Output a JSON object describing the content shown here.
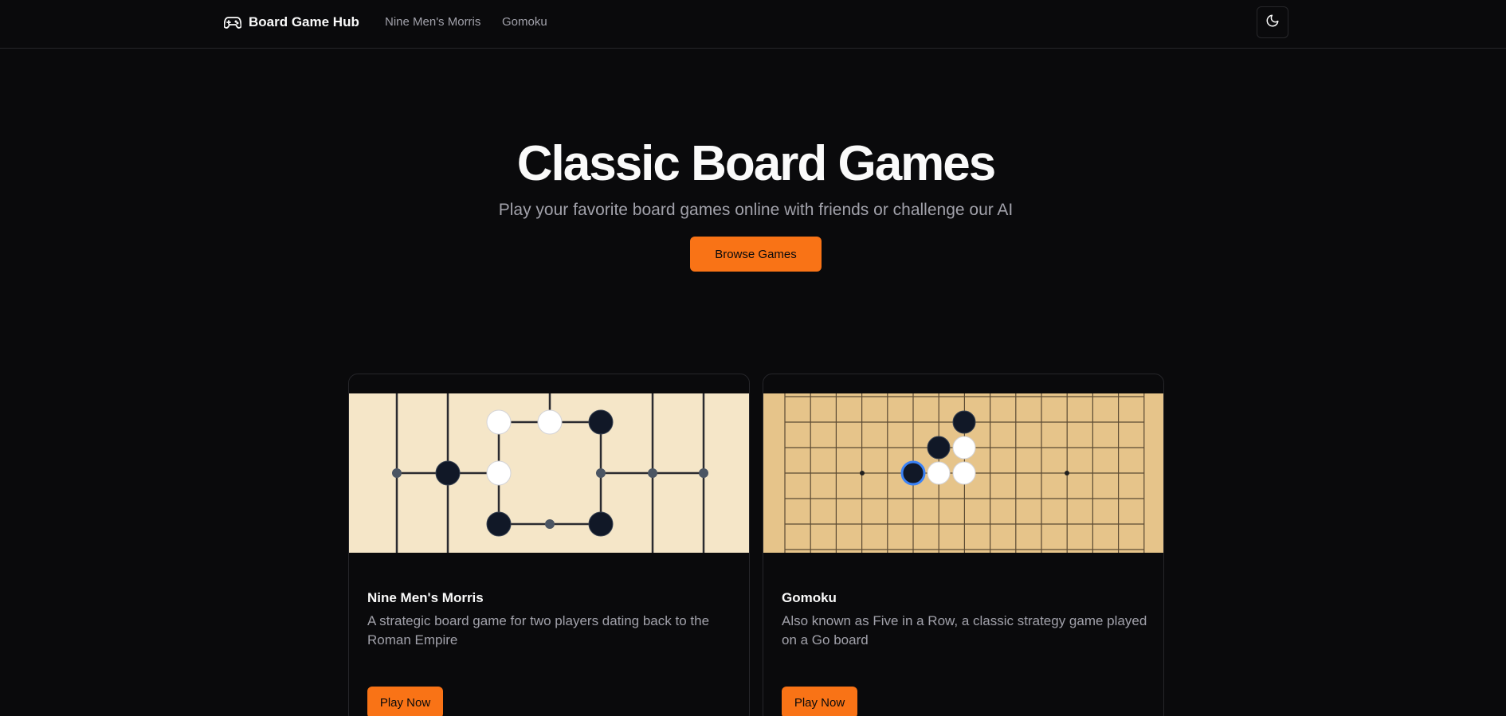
{
  "header": {
    "brand": "Board Game Hub",
    "brand_icon": "gamepad-icon",
    "nav": [
      "Nine Men's Morris",
      "Gomoku"
    ],
    "theme_toggle_icon": "moon-icon"
  },
  "hero": {
    "title": "Classic Board Games",
    "subtitle": "Play your favorite board games online with friends or challenge our AI",
    "cta": "Browse Games"
  },
  "games": [
    {
      "title": "Nine Men's Morris",
      "description": "A strategic board game for two players dating back to the Roman Empire",
      "button": "Play Now",
      "board_color": "#f5e6c8"
    },
    {
      "title": "Gomoku",
      "description": "Also known as Five in a Row, a classic strategy game played on a Go board",
      "button": "Play Now",
      "board_color": "#e6c48a"
    }
  ],
  "colors": {
    "accent": "#f97316",
    "background": "#0a0a0c",
    "muted_text": "#a1a1aa"
  }
}
